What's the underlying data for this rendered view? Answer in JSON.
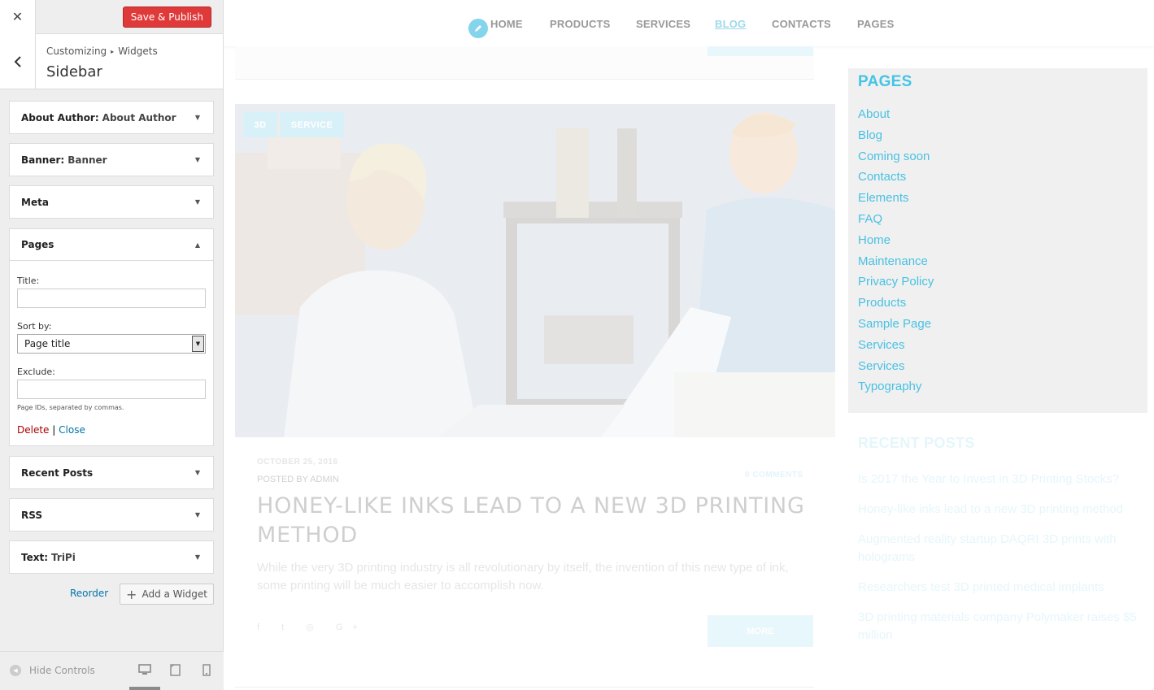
{
  "panel": {
    "close_icon": "close-icon",
    "save_label": "Save & Publish",
    "breadcrumb": [
      "Customizing",
      "Widgets"
    ],
    "section_title": "Sidebar",
    "widgets": [
      {
        "name": "About Author",
        "subtitle": "About Author"
      },
      {
        "name": "Banner",
        "subtitle": "Banner"
      },
      {
        "name": "Meta",
        "subtitle": ""
      },
      {
        "name": "Pages",
        "subtitle": ""
      },
      {
        "name": "Recent Posts",
        "subtitle": ""
      },
      {
        "name": "RSS",
        "subtitle": ""
      },
      {
        "name": "Text",
        "subtitle": "TriPi"
      }
    ],
    "pages_form": {
      "title_label": "Title:",
      "title_value": "",
      "sort_label": "Sort by:",
      "sort_value": "Page title",
      "exclude_label": "Exclude:",
      "exclude_value": "",
      "hint": "Page IDs, separated by commas.",
      "delete_label": "Delete",
      "separator": "|",
      "close_label": "Close"
    },
    "reorder_label": "Reorder",
    "add_widget_label": "Add a Widget",
    "hide_controls_label": "Hide Controls"
  },
  "preview": {
    "nav": [
      "HOME",
      "PRODUCTS",
      "SERVICES",
      "BLOG",
      "CONTACTS",
      "PAGES"
    ],
    "active_nav": "BLOG",
    "post": {
      "tags": [
        "3D",
        "SERVICE"
      ],
      "date": "OCTOBER 25, 2016",
      "author": "POSTED BY ADMIN",
      "comments": "0 COMMENTS",
      "title": "HONEY-LIKE INKS LEAD TO A NEW 3D PRINTING METHOD",
      "excerpt": "While the very 3D printing industry is all revolutionary by itself, the invention of this new type of ink, some printing will be much easier to accomplish now.",
      "social": "f t ◎ G+",
      "more_label": "MORE"
    },
    "pages_widget": {
      "heading": "PAGES",
      "items": [
        "About",
        "Blog",
        "Coming soon",
        "Contacts",
        "Elements",
        "FAQ",
        "Home",
        "Maintenance",
        "Privacy Policy",
        "Products",
        "Sample Page",
        "Services",
        "Services",
        "Typography"
      ]
    },
    "recent_posts": {
      "heading": "RECENT POSTS",
      "items": [
        "Is 2017 the Year to Invest in 3D Printing Stocks?",
        "Honey-like inks lead to a new 3D printing method",
        "Augmented reality startup DAQRI 3D prints with holograms",
        "Researchers test 3D printed medical implants",
        "3D printing materials company Polymaker raises $5 million"
      ]
    }
  },
  "colors": {
    "save_button": "#e0393a",
    "link": "#0073aa",
    "delete": "#aa0000",
    "accent": "#48c1e3"
  }
}
